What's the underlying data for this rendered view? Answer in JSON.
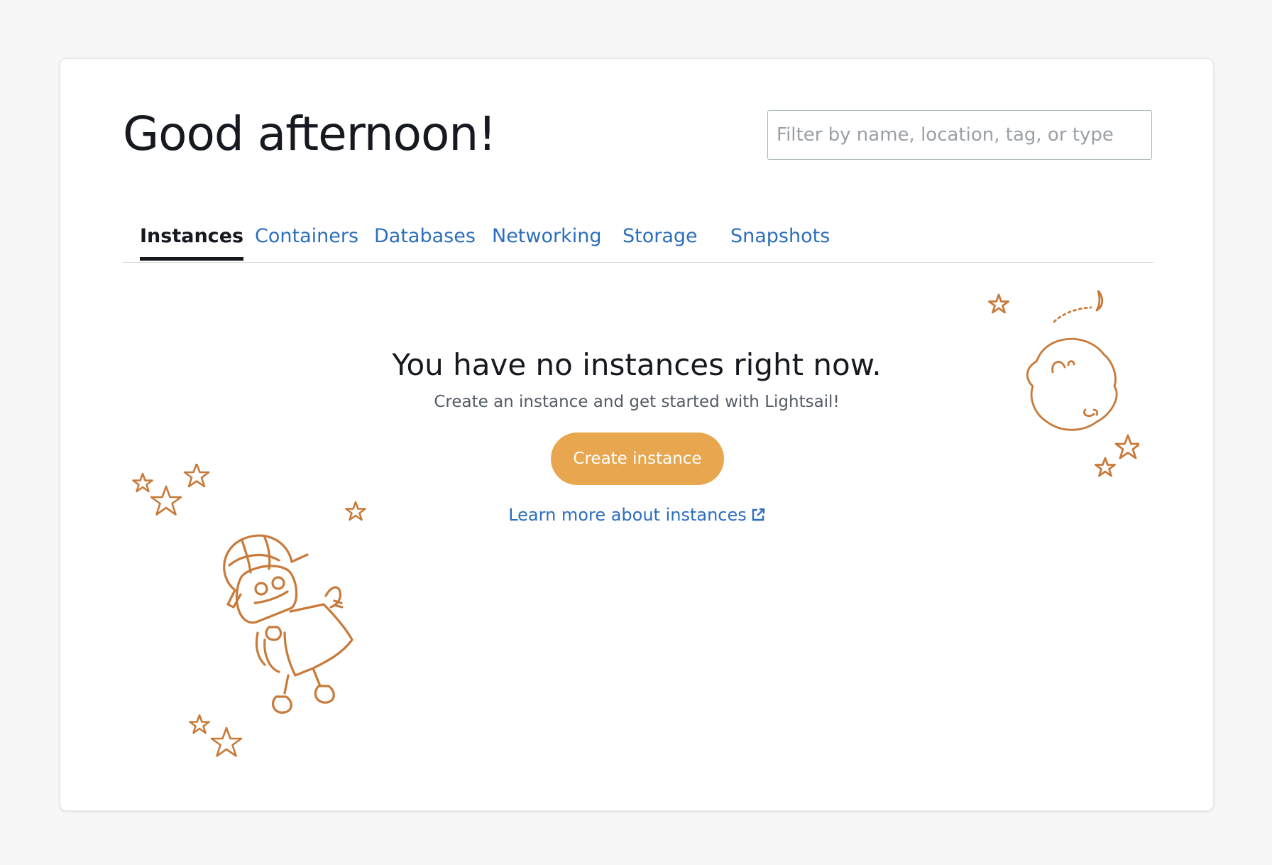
{
  "header": {
    "greeting": "Good afternoon!",
    "filter_placeholder": "Filter by name, location, tag, or type"
  },
  "tabs": [
    {
      "label": "Instances",
      "active": true
    },
    {
      "label": "Containers",
      "active": false
    },
    {
      "label": "Databases",
      "active": false
    },
    {
      "label": "Networking",
      "active": false
    },
    {
      "label": "Storage",
      "active": false
    },
    {
      "label": "Snapshots",
      "active": false
    }
  ],
  "empty_state": {
    "title": "You have no instances right now.",
    "subtitle": "Create an instance and get started with Lightsail!",
    "button_label": "Create instance",
    "link_label": "Learn more about instances"
  },
  "colors": {
    "accent": "#e8a64e",
    "link": "#2c6ebd",
    "illustration": "#c77a3a"
  },
  "icons": [
    "external-link-icon",
    "robot-illustration",
    "moon-illustration",
    "star-icon"
  ]
}
